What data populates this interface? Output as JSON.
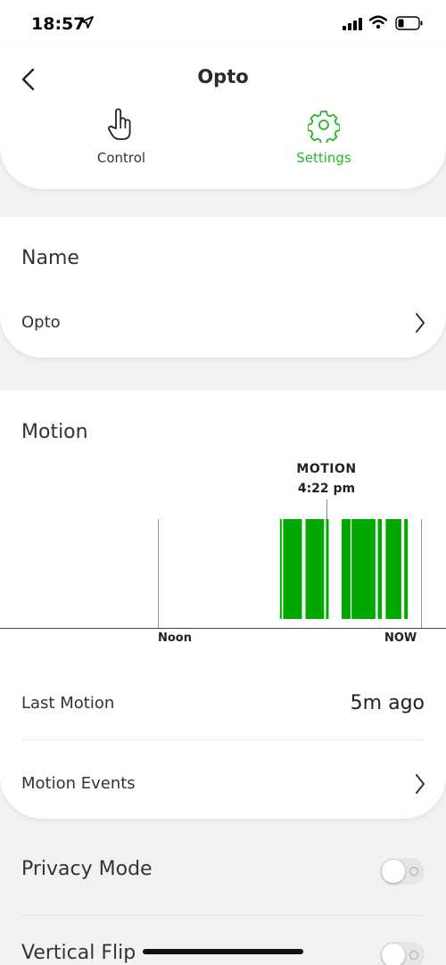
{
  "status_bar": {
    "time": "18:57",
    "icons": [
      "location-arrow-icon",
      "cellular-signal-icon",
      "wifi-icon",
      "battery-icon"
    ]
  },
  "header": {
    "title": "Opto",
    "back_icon": "chevron-left-icon",
    "tabs": [
      {
        "label": "Control",
        "icon": "hand-pointer-icon",
        "active": false
      },
      {
        "label": "Settings",
        "icon": "gear-icon",
        "active": true
      }
    ]
  },
  "name_section": {
    "heading": "Name",
    "value": "Opto"
  },
  "motion_section": {
    "heading": "Motion",
    "marker_title": "MOTION",
    "marker_time": "4:22 pm",
    "axis_labels": {
      "noon": "Noon",
      "now": "NOW"
    },
    "last_motion_label": "Last Motion",
    "last_motion_value": "5m ago",
    "events_label": "Motion Events"
  },
  "chart_data": {
    "type": "bar",
    "title": "",
    "xlabel": "",
    "ylabel": "",
    "marker": {
      "label": "MOTION",
      "time": "4:22 pm"
    },
    "tick_labels": [
      "Noon",
      "NOW"
    ],
    "motion_intervals_hours_after_noon": [
      [
        4.15,
        4.2
      ],
      [
        4.26,
        4.9
      ],
      [
        5.02,
        5.65
      ],
      [
        5.72,
        5.81
      ],
      [
        6.25,
        6.55
      ],
      [
        6.59,
        7.4
      ],
      [
        7.48,
        7.62
      ],
      [
        7.75,
        8.28
      ],
      [
        8.38,
        8.5
      ]
    ],
    "x_range_hours_after_noon": [
      -6.0,
      9.2
    ],
    "colors": {
      "motion": "#00a800",
      "accent": "#28b428"
    }
  },
  "toggles": [
    {
      "label": "Privacy Mode",
      "on": false
    },
    {
      "label": "Vertical Flip",
      "on": false
    }
  ]
}
